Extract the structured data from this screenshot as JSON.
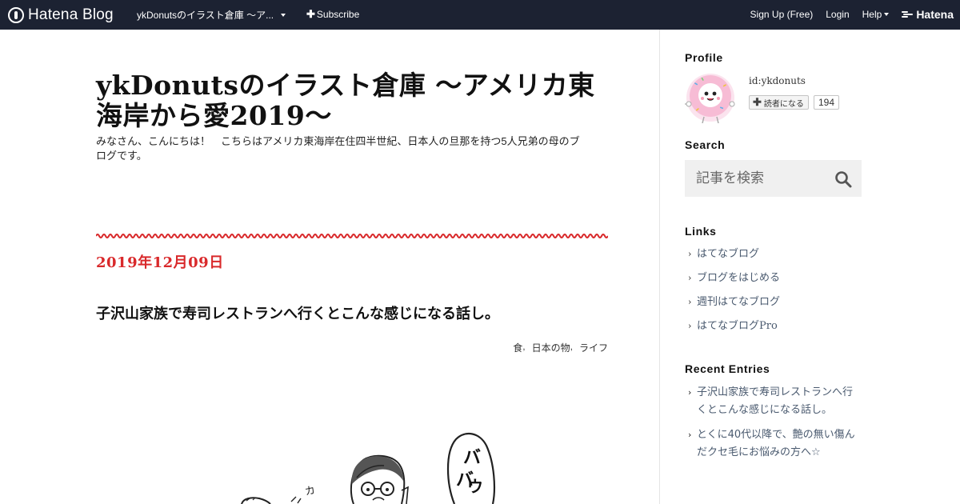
{
  "header": {
    "logo_text": "Hatena Blog",
    "blog_name": "ykDonutsのイラスト倉庫 ～ア...",
    "subscribe_label": "Subscribe",
    "signup_label": "Sign Up (Free)",
    "login_label": "Login",
    "help_label": "Help",
    "hatena_label": "Hatena",
    "bg_color": "#1c2232"
  },
  "blog": {
    "title": "ykDonutsのイラスト倉庫 ～アメリカ東海岸から愛2019～",
    "description": "みなさん、こんにちは！　こちらはアメリカ東海岸在住四半世紀、日本人の旦那を持つ5人兄弟の母のブログです。"
  },
  "entry": {
    "date": "2019年12月09日",
    "title": "子沢山家族で寿司レストランへ行くとこんな感じになる話し。",
    "categories": [
      "食",
      "日本の物",
      "ライフ"
    ],
    "date_color": "#d9292b"
  },
  "sidebar": {
    "profile": {
      "heading": "Profile",
      "user_id": "id:ykdonuts",
      "reader_button_label": "読者になる",
      "reader_count": "194"
    },
    "search": {
      "heading": "Search",
      "placeholder": "記事を検索"
    },
    "links": {
      "heading": "Links",
      "items": [
        {
          "label": "はてなブログ"
        },
        {
          "label": "ブログをはじめる"
        },
        {
          "label": "週刊はてなブログ"
        },
        {
          "label": "はてなブログPro"
        }
      ]
    },
    "recent_entries": {
      "heading": "Recent Entries",
      "items": [
        {
          "label": "子沢山家族で寿司レストランへ行くとこんな感じになる話し。"
        },
        {
          "label": "とくに40代以降で、艶の無い傷んだクセ毛にお悩みの方へ☆"
        }
      ]
    }
  },
  "illustration": {
    "sfx_text_1": "バ",
    "sfx_text_2": "ウ",
    "sfx_small": "カ"
  }
}
